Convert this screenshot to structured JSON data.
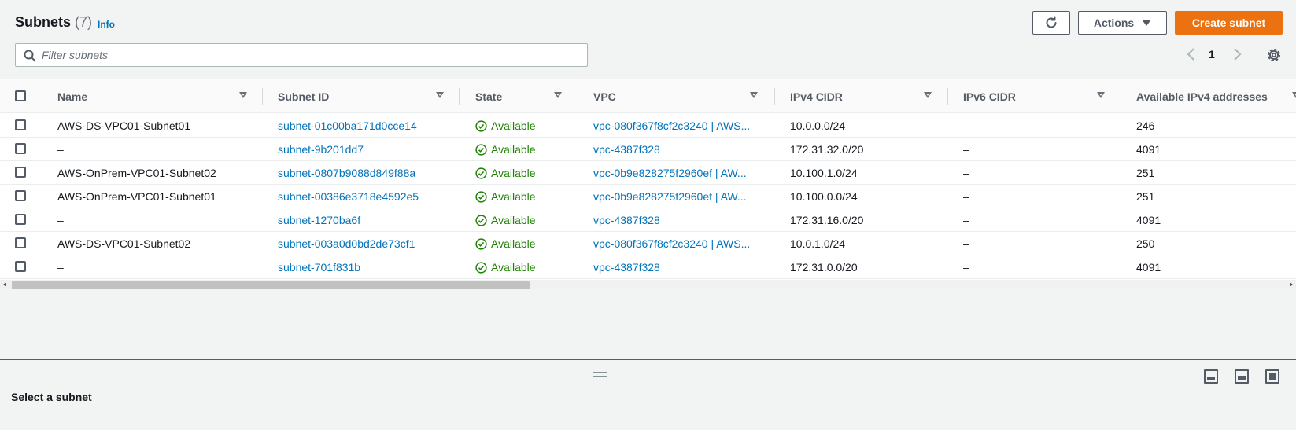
{
  "header": {
    "title": "Subnets",
    "count": "(7)",
    "info_label": "Info",
    "actions_label": "Actions",
    "create_label": "Create subnet"
  },
  "search": {
    "placeholder": "Filter subnets",
    "value": ""
  },
  "pagination": {
    "current_page": "1"
  },
  "table": {
    "columns": [
      "Name",
      "Subnet ID",
      "State",
      "VPC",
      "IPv4 CIDR",
      "IPv6 CIDR",
      "Available IPv4 addresses"
    ],
    "rows": [
      {
        "name": "AWS-DS-VPC01-Subnet01",
        "subnet_id": "subnet-01c00ba171d0cce14",
        "state": "Available",
        "vpc": "vpc-080f367f8cf2c3240 | AWS...",
        "ipv4": "10.0.0.0/24",
        "ipv6": "–",
        "available": "246"
      },
      {
        "name": "–",
        "subnet_id": "subnet-9b201dd7",
        "state": "Available",
        "vpc": "vpc-4387f328",
        "ipv4": "172.31.32.0/20",
        "ipv6": "–",
        "available": "4091"
      },
      {
        "name": "AWS-OnPrem-VPC01-Subnet02",
        "subnet_id": "subnet-0807b9088d849f88a",
        "state": "Available",
        "vpc": "vpc-0b9e828275f2960ef | AW...",
        "ipv4": "10.100.1.0/24",
        "ipv6": "–",
        "available": "251"
      },
      {
        "name": "AWS-OnPrem-VPC01-Subnet01",
        "subnet_id": "subnet-00386e3718e4592e5",
        "state": "Available",
        "vpc": "vpc-0b9e828275f2960ef | AW...",
        "ipv4": "10.100.0.0/24",
        "ipv6": "–",
        "available": "251"
      },
      {
        "name": "–",
        "subnet_id": "subnet-1270ba6f",
        "state": "Available",
        "vpc": "vpc-4387f328",
        "ipv4": "172.31.16.0/20",
        "ipv6": "–",
        "available": "4091"
      },
      {
        "name": "AWS-DS-VPC01-Subnet02",
        "subnet_id": "subnet-003a0d0bd2de73cf1",
        "state": "Available",
        "vpc": "vpc-080f367f8cf2c3240 | AWS...",
        "ipv4": "10.0.1.0/24",
        "ipv6": "–",
        "available": "250"
      },
      {
        "name": "–",
        "subnet_id": "subnet-701f831b",
        "state": "Available",
        "vpc": "vpc-4387f328",
        "ipv4": "172.31.0.0/20",
        "ipv6": "–",
        "available": "4091"
      }
    ]
  },
  "split_panel": {
    "title": "Select a subnet"
  },
  "icons": {
    "refresh": "refresh-icon",
    "search": "search-icon",
    "settings": "gear-icon",
    "status": "check-circle-icon"
  },
  "colors": {
    "link": "#0073bb",
    "primary": "#ec7211",
    "success": "#1d8102"
  }
}
